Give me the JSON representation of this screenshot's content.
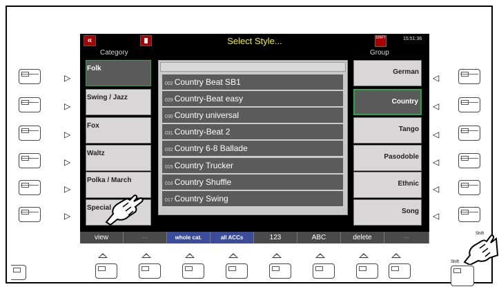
{
  "screen": {
    "title": "Select Style...",
    "clock": "15:51:36",
    "back_label": "«",
    "shift_indicator": "SHIFT",
    "category_label": "Category",
    "group_label": "Group"
  },
  "categories": [
    {
      "label": "Folk",
      "active": true
    },
    {
      "label": "Swing / Jazz",
      "active": false
    },
    {
      "label": "Fox",
      "active": false
    },
    {
      "label": "Waltz",
      "active": false
    },
    {
      "label": "Polka / March",
      "active": false
    },
    {
      "label": "Special",
      "active": false
    }
  ],
  "groups": [
    {
      "label": "German",
      "active": false
    },
    {
      "label": "Country",
      "active": true
    },
    {
      "label": "Tango",
      "active": false
    },
    {
      "label": "Pasodoble",
      "active": false
    },
    {
      "label": "Ethnic",
      "active": false
    },
    {
      "label": "Song",
      "active": false
    }
  ],
  "styles": [
    {
      "num": "002",
      "name": "Country Beat SB1"
    },
    {
      "num": "029",
      "name": "Country-Beat easy"
    },
    {
      "num": "030",
      "name": "Country universal"
    },
    {
      "num": "031",
      "name": "Country-Beat 2"
    },
    {
      "num": "032",
      "name": "Country 6-8 Ballade"
    },
    {
      "num": "015",
      "name": "Country Trucker"
    },
    {
      "num": "016",
      "name": "Country Shuffle"
    },
    {
      "num": "017",
      "name": "Country Swing"
    }
  ],
  "softkeys": [
    "view",
    "---",
    "whole cat.",
    "all ACCs",
    "123",
    "ABC",
    "delete",
    "---"
  ],
  "shift_labels": {
    "upper": "Shift",
    "lower": "Shift"
  },
  "colors": {
    "title": "#f4f400",
    "active_border": "#2aa84a",
    "softkey_blue": "#3b4d9a",
    "header_red": "#a80000"
  }
}
